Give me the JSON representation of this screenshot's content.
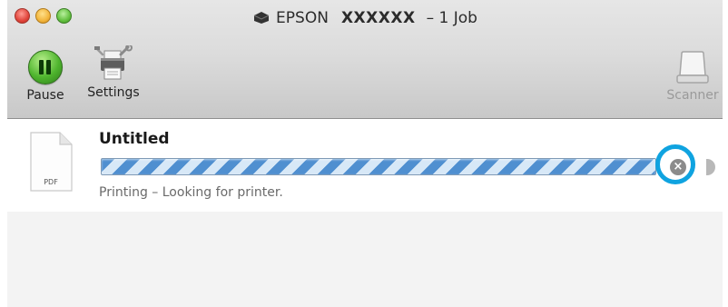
{
  "window": {
    "title_brand": "EPSON",
    "title_model": "XXXXXX",
    "title_suffix": "– 1 Job"
  },
  "toolbar": {
    "pause_label": "Pause",
    "settings_label": "Settings",
    "scanner_label": "Scanner"
  },
  "job": {
    "document_name": "Untitled",
    "file_type": "PDF",
    "status": "Printing – Looking for printer.",
    "progress": "indeterminate"
  },
  "icons": {
    "printer": "printer-icon",
    "pause": "pause-icon",
    "settings": "settings-icon",
    "scanner": "scanner-icon",
    "document": "pdf-document-icon",
    "cancel": "cancel-icon"
  },
  "colors": {
    "progress_blue": "#4f8fd0",
    "highlight_ring": "#0fa3e0",
    "pause_green": "#4fb52e"
  }
}
